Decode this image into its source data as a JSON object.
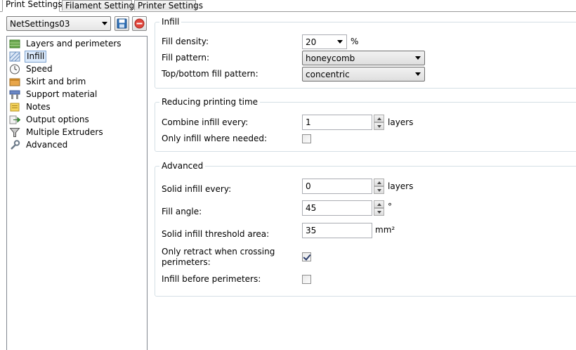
{
  "tabs": [
    {
      "label": "Print Settings",
      "active": true
    },
    {
      "label": "Filament Settings",
      "active": false
    },
    {
      "label": "Printer Settings",
      "active": false
    }
  ],
  "preset": {
    "value": "NetSettings03"
  },
  "tree": {
    "items": [
      {
        "label": "Layers and perimeters",
        "icon": "layers-icon",
        "selected": false
      },
      {
        "label": "Infill",
        "icon": "infill-icon",
        "selected": true
      },
      {
        "label": "Speed",
        "icon": "clock-icon",
        "selected": false
      },
      {
        "label": "Skirt and brim",
        "icon": "box-icon",
        "selected": false
      },
      {
        "label": "Support material",
        "icon": "support-icon",
        "selected": false
      },
      {
        "label": "Notes",
        "icon": "note-icon",
        "selected": false
      },
      {
        "label": "Output options",
        "icon": "output-arrow-icon",
        "selected": false
      },
      {
        "label": "Multiple Extruders",
        "icon": "funnel-icon",
        "selected": false
      },
      {
        "label": "Advanced",
        "icon": "wrench-icon",
        "selected": false
      }
    ]
  },
  "infill": {
    "title": "Infill",
    "fill_density_label": "Fill density:",
    "fill_density_value": "20",
    "fill_density_unit": "%",
    "fill_pattern_label": "Fill pattern:",
    "fill_pattern_value": "honeycomb",
    "top_bottom_label": "Top/bottom fill pattern:",
    "top_bottom_value": "concentric"
  },
  "reducing": {
    "title": "Reducing printing time",
    "combine_label": "Combine infill every:",
    "combine_value": "1",
    "combine_unit": "layers",
    "only_infill_label": "Only infill where needed:",
    "only_infill_checked": false
  },
  "advanced": {
    "title": "Advanced",
    "solid_every_label": "Solid infill every:",
    "solid_every_value": "0",
    "solid_every_unit": "layers",
    "fill_angle_label": "Fill angle:",
    "fill_angle_value": "45",
    "fill_angle_unit": "°",
    "threshold_label": "Solid infill threshold area:",
    "threshold_value": "35",
    "threshold_unit": "mm²",
    "retract_label_line1": "Only retract when crossing",
    "retract_label_line2": "perimeters:",
    "retract_checked": true,
    "before_perimeters_label": "Infill before perimeters:",
    "before_perimeters_checked": false
  }
}
